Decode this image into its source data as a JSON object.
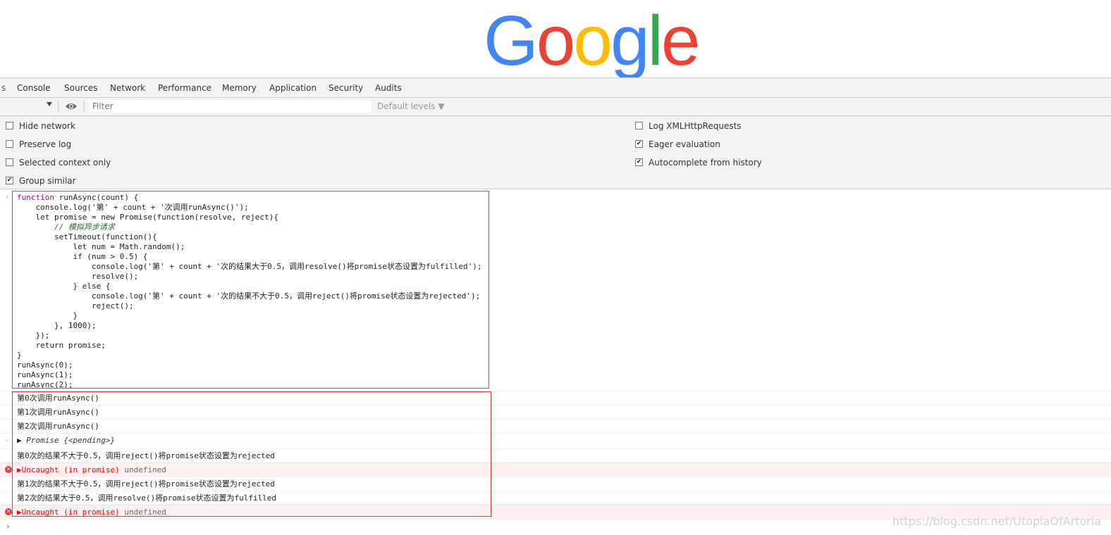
{
  "logo": {
    "letters": [
      "G",
      "o",
      "o",
      "g",
      "l",
      "e"
    ],
    "colors": [
      "#4285F4",
      "#EA4335",
      "#FBBC05",
      "#4285F4",
      "#34A853",
      "#EA4335"
    ]
  },
  "tabs": [
    "Console",
    "Sources",
    "Network",
    "Performance",
    "Memory",
    "Application",
    "Security",
    "Audits"
  ],
  "toolbar": {
    "filter_placeholder": "Filter",
    "levels_label": "Default levels ▼"
  },
  "settings": {
    "left": [
      {
        "label": "Hide network",
        "checked": false
      },
      {
        "label": "Preserve log",
        "checked": false
      },
      {
        "label": "Selected context only",
        "checked": false
      },
      {
        "label": "Group similar",
        "checked": true
      }
    ],
    "right": [
      {
        "label": "Log XMLHttpRequests",
        "checked": false
      },
      {
        "label": "Eager evaluation",
        "checked": true
      },
      {
        "label": "Autocomplete from history",
        "checked": true
      }
    ]
  },
  "code_lines": [
    "function runAsync(count) {",
    "    console.log('第' + count + '次调用runAsync()');",
    "    let promise = new Promise(function(resolve, reject){",
    "        // 模拟异步请求",
    "        setTimeout(function(){",
    "            let num = Math.random();",
    "            if (num > 0.5) {",
    "                console.log('第' + count + '次的结果大于0.5，调用resolve()将promise状态设置为fulfilled');",
    "                resolve();",
    "            } else {",
    "                console.log('第' + count + '次的结果不大于0.5，调用reject()将promise状态设置为rejected');",
    "                reject();",
    "            }",
    "        }, 1000);",
    "    });",
    "    return promise;",
    "}",
    "runAsync(0);",
    "runAsync(1);",
    "runAsync(2);"
  ],
  "output": {
    "log0": "第0次调用runAsync()",
    "log1": "第1次调用runAsync()",
    "log2": "第2次调用runAsync()",
    "promise_label": "Promise",
    "promise_state": "{<pending>}",
    "log3": "第0次的结果不大于0.5，调用reject()将promise状态设置为rejected",
    "err1_label": "Uncaught (in promise)",
    "err1_value": "undefined",
    "log4": "第1次的结果不大于0.5，调用reject()将promise状态设置为rejected",
    "log5": "第2次的结果大于0.5，调用resolve()将promise状态设置为fulfilled",
    "err2_label": "Uncaught (in promise)",
    "err2_value": "undefined"
  },
  "watermark": "https://blog.csdn.net/UtopiaOfArtoria"
}
